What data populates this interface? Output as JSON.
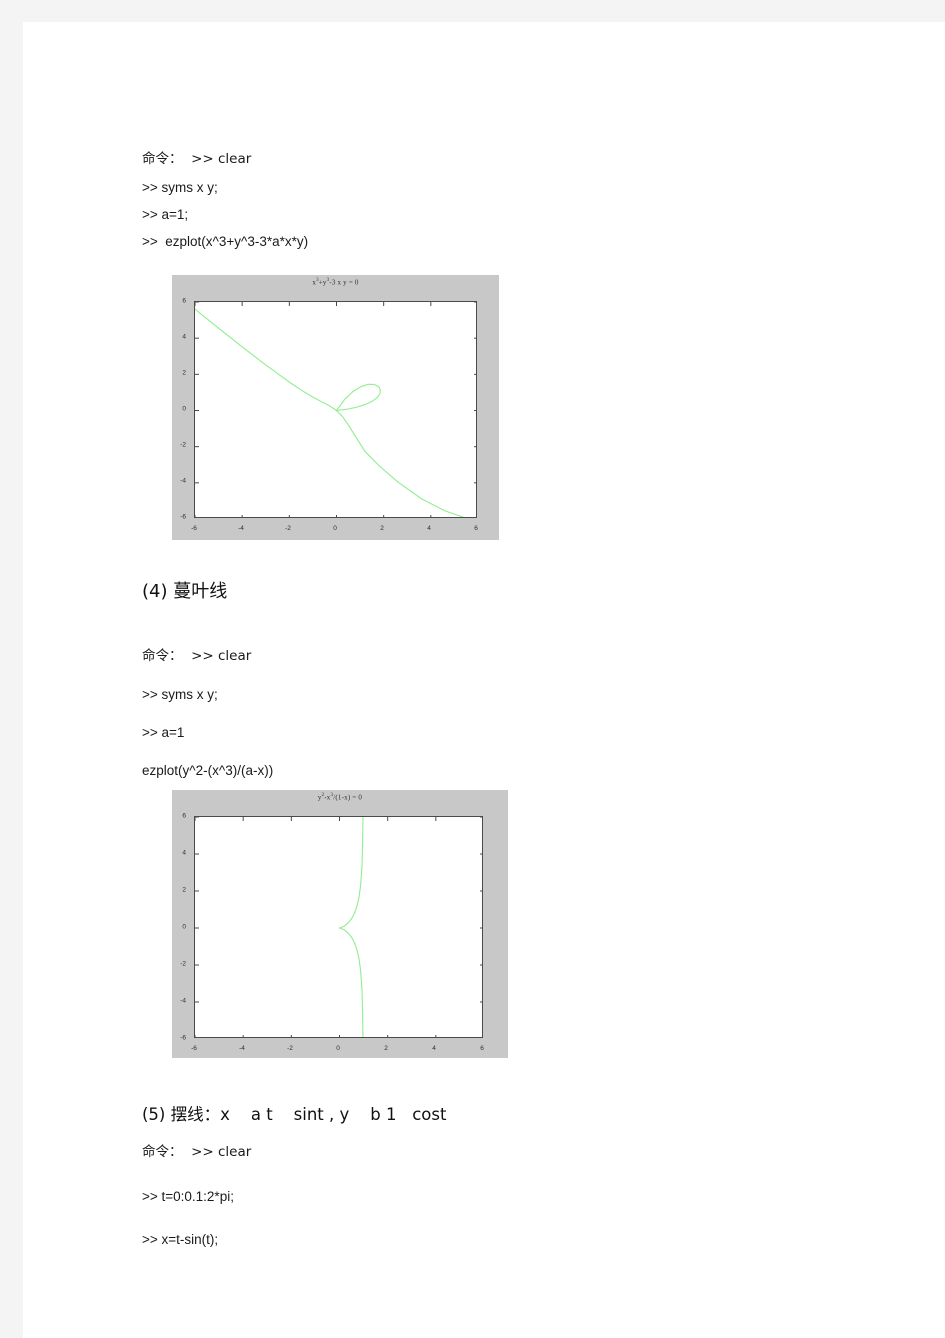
{
  "page": {
    "background": "#f4f4f4",
    "paper": "#ffffff"
  },
  "colors": {
    "curve": "#90ee90",
    "figure_panel": "#c8c8c8",
    "axes_border": "#4a4a4a",
    "text": "#1a1a1a"
  },
  "blocks": [
    {
      "id": "cmd1",
      "text": "命令：  >> clear"
    },
    {
      "id": "cmd2",
      "text": ">> syms x y;"
    },
    {
      "id": "cmd3",
      "text": ">> a=1;"
    },
    {
      "id": "cmd4",
      "text": ">>  ezplot(x^3+y^3-3*a*x*y)"
    },
    {
      "id": "head4",
      "text": "(4) 蔓叶线"
    },
    {
      "id": "cmd5",
      "text": "命令：  >> clear"
    },
    {
      "id": "cmd6",
      "text": ">> syms x y;"
    },
    {
      "id": "cmd7",
      "text": ">> a=1"
    },
    {
      "id": "cmd8",
      "text": "ezplot(y^2-(x^3)/(a-x))"
    },
    {
      "id": "head5",
      "text": "(5) 摆线：x    a t    sint , y    b 1   cost"
    },
    {
      "id": "cmd9",
      "text": "命令：  >> clear"
    },
    {
      "id": "cmd10",
      "text": ">> t=0:0.1:2*pi;"
    },
    {
      "id": "cmd11",
      "text": ">> x=t-sin(t);"
    }
  ],
  "chart_data": [
    {
      "id": "folium",
      "type": "line",
      "title": "x³+y³-3 x y = 0",
      "title_parts": {
        "pre": "x",
        "sup1": "3",
        "mid": "+y",
        "sup2": "3",
        "post": "-3 x y = 0"
      },
      "equation": "x^3 + y^3 - 3*a*x*y = 0",
      "parameter_a": 1,
      "xlabel": "",
      "ylabel": "",
      "xlim": [
        -6,
        6
      ],
      "ylim": [
        -6,
        6
      ],
      "xticks": [
        -6,
        -4,
        -2,
        0,
        2,
        4,
        6
      ],
      "yticks": [
        6,
        4,
        2,
        0,
        -2,
        -4,
        -6
      ],
      "xtick_labels": [
        "-6",
        "-4",
        "-2",
        "0",
        "2",
        "4",
        "6"
      ],
      "ytick_labels": [
        "6",
        "4",
        "2",
        "0",
        "-2",
        "-4",
        "-6"
      ],
      "grid": false,
      "legend": "none",
      "series": [
        {
          "name": "folium-asymptotic-branch",
          "comment": "branch approaching asymptote x+y+1=0, drawn from upper-left to lower-right",
          "points": [
            [
              -6.0,
              5.6
            ],
            [
              -5.0,
              4.55
            ],
            [
              -4.0,
              3.52
            ],
            [
              -3.0,
              2.52
            ],
            [
              -2.0,
              1.57
            ],
            [
              -1.5,
              1.13
            ],
            [
              -1.0,
              0.74
            ],
            [
              -0.6,
              0.46
            ],
            [
              -0.3,
              0.26
            ],
            [
              0.0,
              0.0
            ],
            [
              0.25,
              -0.33
            ],
            [
              0.5,
              -0.79
            ],
            [
              0.8,
              -1.42
            ],
            [
              1.2,
              -2.25
            ],
            [
              1.8,
              -3.05
            ],
            [
              2.6,
              -3.95
            ],
            [
              3.6,
              -4.88
            ],
            [
              4.6,
              -5.55
            ],
            [
              5.6,
              -6.0
            ]
          ]
        },
        {
          "name": "folium-loop",
          "comment": "closed loop in first quadrant, max extent near (1.5,1.5)",
          "points": [
            [
              0.0,
              0.0
            ],
            [
              0.35,
              0.62
            ],
            [
              0.7,
              1.05
            ],
            [
              1.05,
              1.33
            ],
            [
              1.35,
              1.45
            ],
            [
              1.6,
              1.44
            ],
            [
              1.78,
              1.33
            ],
            [
              1.86,
              1.14
            ],
            [
              1.84,
              0.92
            ],
            [
              1.72,
              0.7
            ],
            [
              1.5,
              0.5
            ],
            [
              1.2,
              0.32
            ],
            [
              0.85,
              0.18
            ],
            [
              0.45,
              0.07
            ],
            [
              0.0,
              0.0
            ]
          ]
        }
      ]
    },
    {
      "id": "cissoid",
      "type": "line",
      "title": "y²-x³/(1-x) = 0",
      "title_parts": {
        "pre": "y",
        "sup1": "2",
        "mid": "-x",
        "sup2": "3",
        "post": "/(1-x) = 0"
      },
      "equation": "y^2 - (x^3)/(a-x) = 0",
      "parameter_a": 1,
      "xlabel": "",
      "ylabel": "",
      "xlim": [
        -6,
        6
      ],
      "ylim": [
        -6,
        6
      ],
      "xticks": [
        -6,
        -4,
        -2,
        0,
        2,
        4,
        6
      ],
      "yticks": [
        6,
        4,
        2,
        0,
        -2,
        -4,
        -6
      ],
      "xtick_labels": [
        "-6",
        "-4",
        "-2",
        "0",
        "2",
        "4",
        "6"
      ],
      "ytick_labels": [
        "6",
        "4",
        "2",
        "0",
        "-2",
        "-4",
        "-6"
      ],
      "grid": false,
      "legend": "none",
      "series": [
        {
          "name": "cissoid-upper",
          "comment": "upper half, cusp at origin, vertical asymptote x=1",
          "points": [
            [
              0.0,
              0.0
            ],
            [
              0.18,
              0.09
            ],
            [
              0.35,
              0.26
            ],
            [
              0.5,
              0.5
            ],
            [
              0.62,
              0.79
            ],
            [
              0.72,
              1.15
            ],
            [
              0.8,
              1.6
            ],
            [
              0.86,
              2.12
            ],
            [
              0.9,
              2.7
            ],
            [
              0.93,
              3.3
            ],
            [
              0.95,
              4.1
            ],
            [
              0.965,
              5.05
            ],
            [
              0.975,
              6.0
            ]
          ]
        },
        {
          "name": "cissoid-lower",
          "comment": "lower half, mirror of upper across the x-axis",
          "points": [
            [
              0.0,
              0.0
            ],
            [
              0.18,
              -0.09
            ],
            [
              0.35,
              -0.26
            ],
            [
              0.5,
              -0.5
            ],
            [
              0.62,
              -0.79
            ],
            [
              0.72,
              -1.15
            ],
            [
              0.8,
              -1.6
            ],
            [
              0.86,
              -2.12
            ],
            [
              0.9,
              -2.7
            ],
            [
              0.93,
              -3.3
            ],
            [
              0.95,
              -4.1
            ],
            [
              0.965,
              -5.05
            ],
            [
              0.975,
              -6.0
            ]
          ]
        }
      ]
    }
  ]
}
